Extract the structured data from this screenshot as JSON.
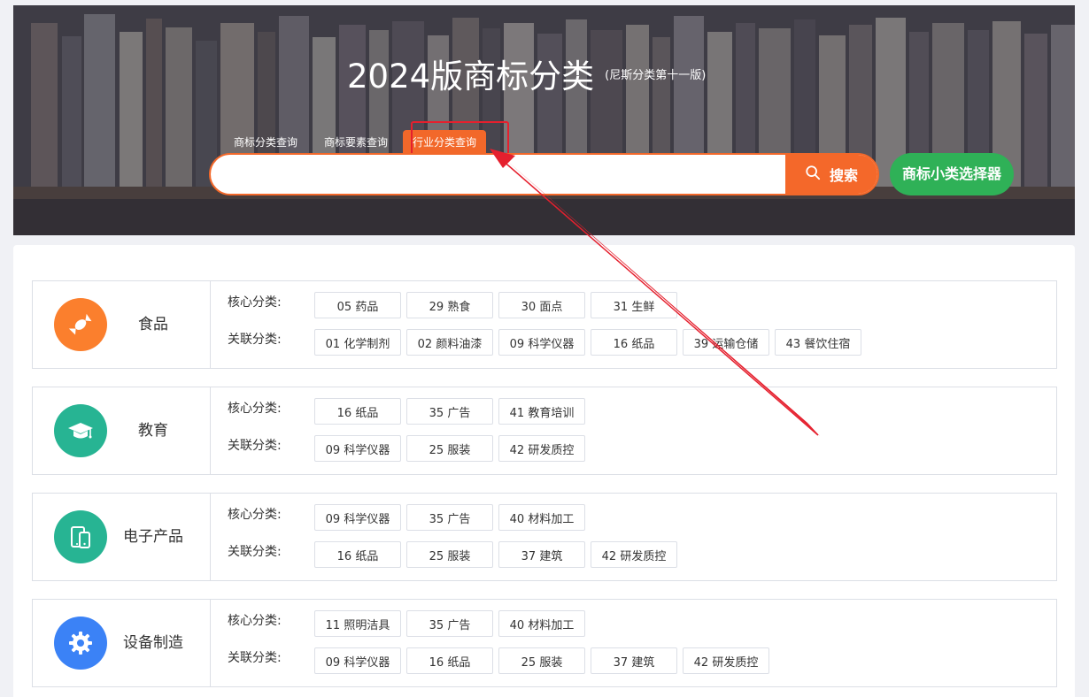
{
  "header": {
    "title": "2024版商标分类",
    "subtitle": "(尼斯分类第十一版)"
  },
  "tabs": [
    {
      "label": "商标分类查询"
    },
    {
      "label": "商标要素查询"
    },
    {
      "label": "行业分类查询",
      "active": true
    }
  ],
  "search": {
    "value": "",
    "placeholder": "",
    "button_label": "搜索",
    "button_icon": "search-icon"
  },
  "selector_button_label": "商标小类选择器",
  "colors": {
    "accent": "#f4682a",
    "selector_green": "#2fb157",
    "annotation_red": "#e5202e"
  },
  "categories": [
    {
      "name": "食品",
      "icon": "candy-icon",
      "icon_color": "#fb7f2d",
      "core_label": "核心分类:",
      "related_label": "关联分类:",
      "core": [
        "05 药品",
        "29 熟食",
        "30 面点",
        "31 生鲜"
      ],
      "related": [
        "01 化学制剂",
        "02 颜料油漆",
        "09 科学仪器",
        "16 纸品",
        "39 运输仓储",
        "43 餐饮住宿"
      ]
    },
    {
      "name": "教育",
      "icon": "graduation-cap-icon",
      "icon_color": "#27b493",
      "core_label": "核心分类:",
      "related_label": "关联分类:",
      "core": [
        "16 纸品",
        "35 广告",
        "41 教育培训"
      ],
      "related": [
        "09 科学仪器",
        "25 服装",
        "42 研发质控"
      ]
    },
    {
      "name": "电子产品",
      "icon": "devices-icon",
      "icon_color": "#27b493",
      "core_label": "核心分类:",
      "related_label": "关联分类:",
      "core": [
        "09 科学仪器",
        "35 广告",
        "40 材料加工"
      ],
      "related": [
        "16 纸品",
        "25 服装",
        "37 建筑",
        "42 研发质控"
      ]
    },
    {
      "name": "设备制造",
      "icon": "gear-icon",
      "icon_color": "#3b82f6",
      "core_label": "核心分类:",
      "related_label": "关联分类:",
      "core": [
        "11 照明洁具",
        "35 广告",
        "40 材料加工"
      ],
      "related": [
        "09 科学仪器",
        "16 纸品",
        "25 服装",
        "37 建筑",
        "42 研发质控"
      ]
    }
  ]
}
